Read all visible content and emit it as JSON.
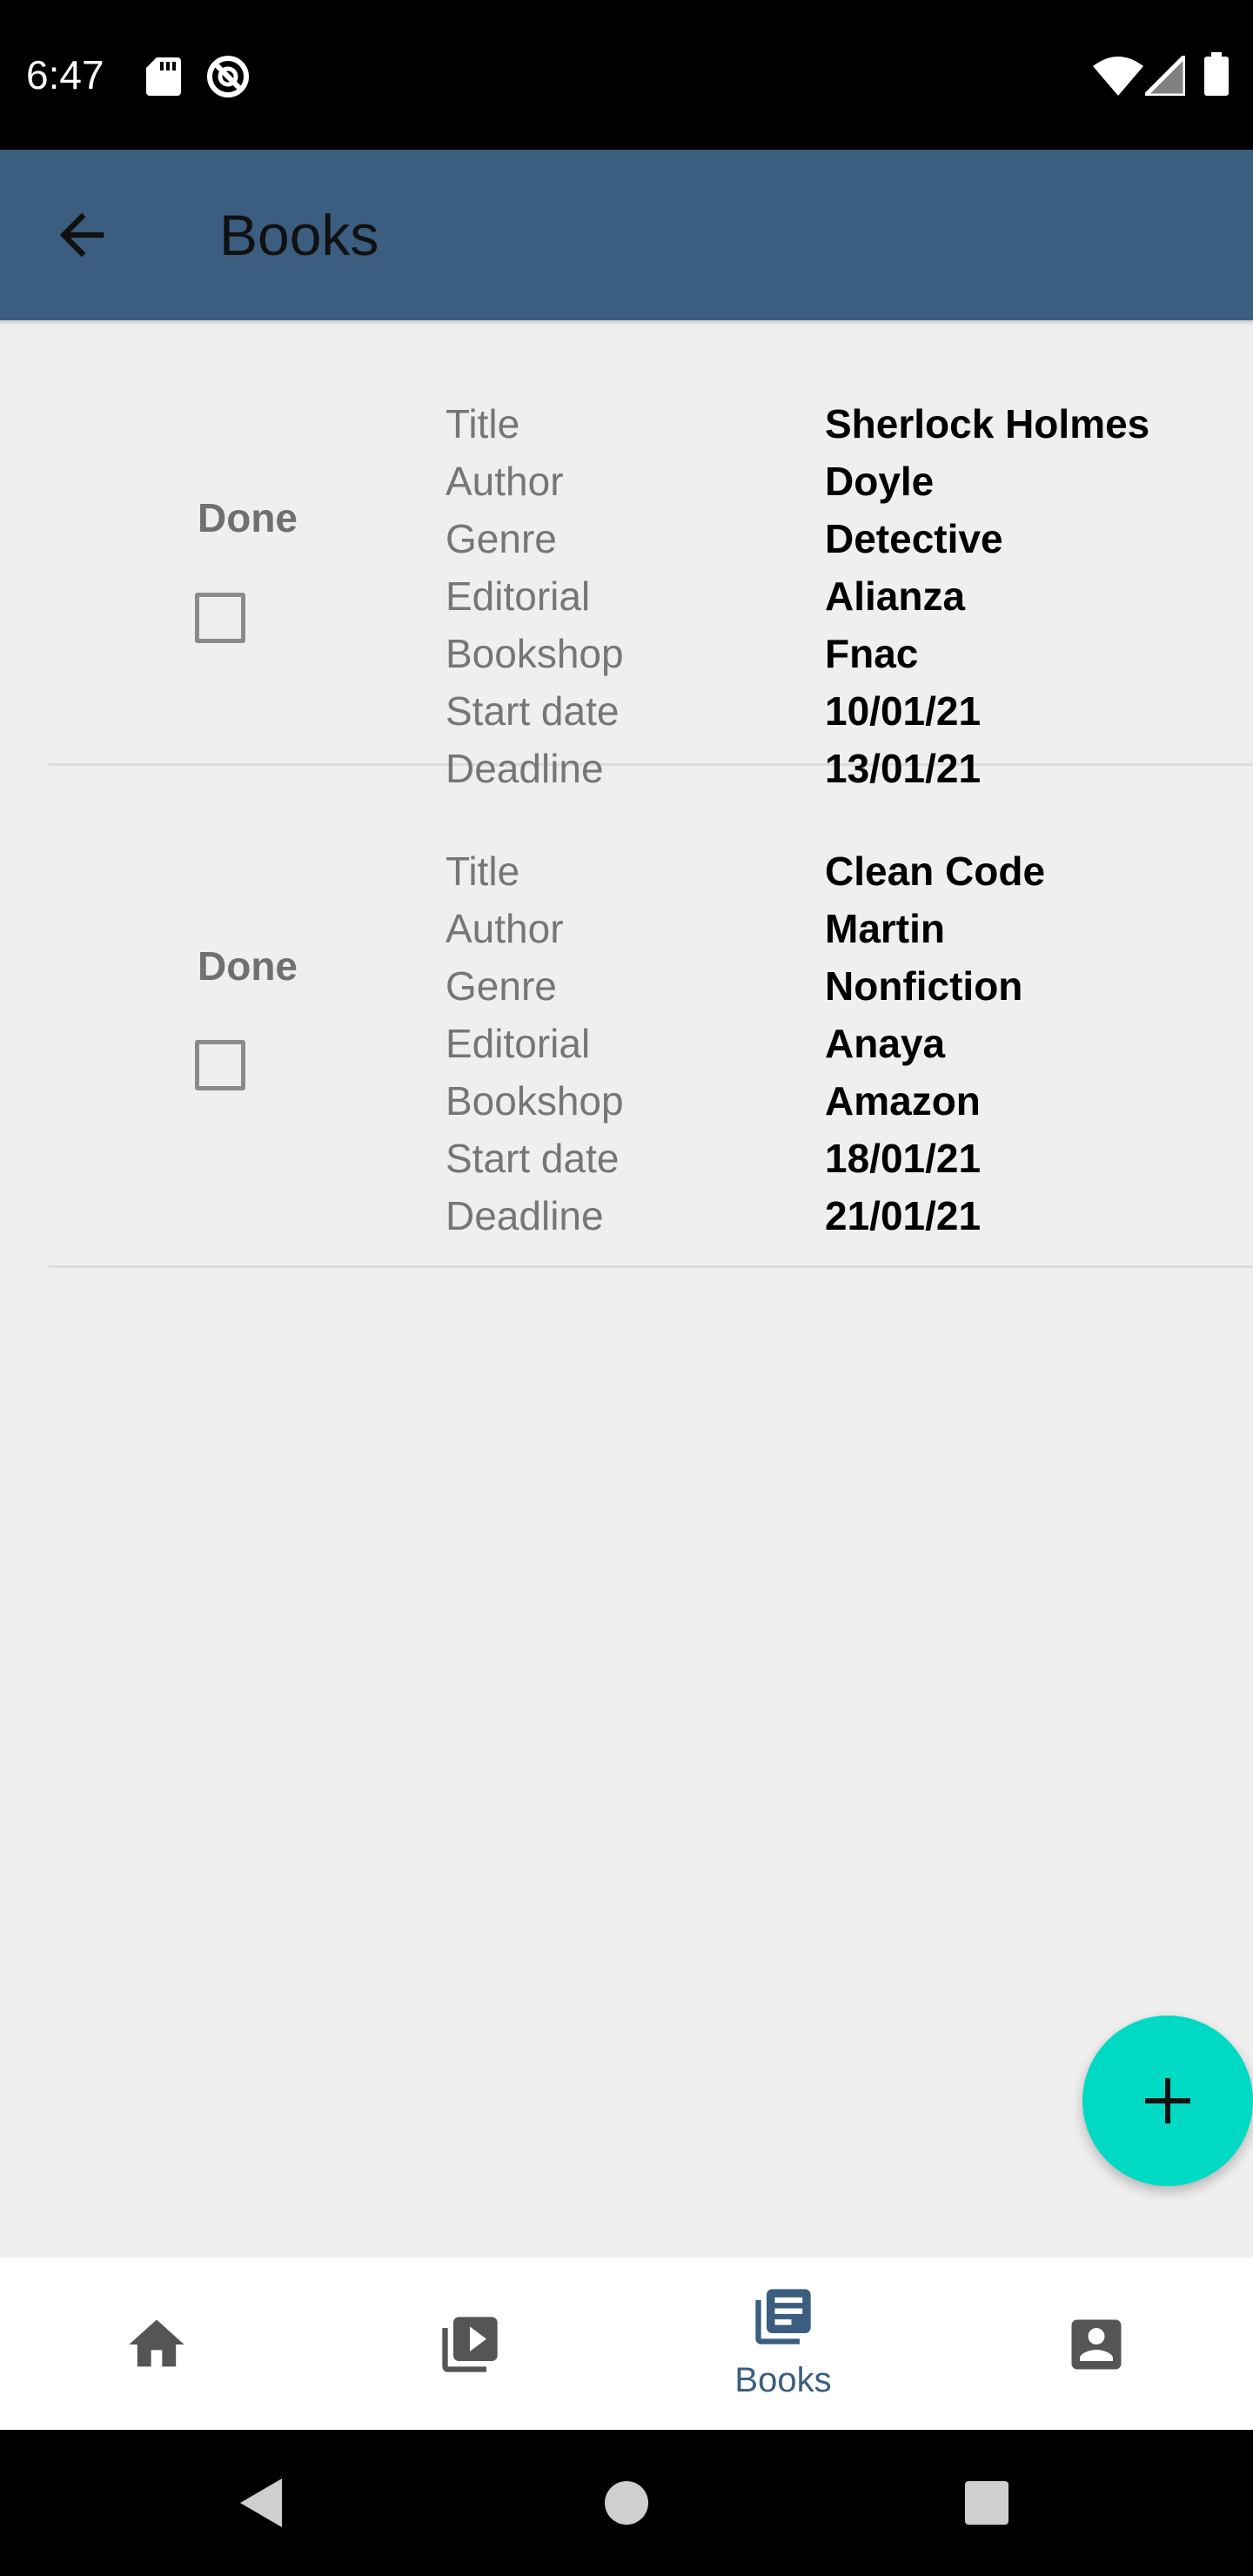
{
  "status_bar": {
    "time": "6:47",
    "left_icons": [
      "sd-card-icon",
      "do-not-disturb-icon"
    ],
    "right_icons": [
      "wifi-icon",
      "cell-signal-icon",
      "battery-icon"
    ]
  },
  "app_bar": {
    "title": "Books",
    "back_icon": "arrow-back-icon"
  },
  "books": [
    {
      "done_label": "Done",
      "done": false,
      "fields": [
        {
          "label": "Title",
          "value": "Sherlock Holmes"
        },
        {
          "label": "Author",
          "value": "Doyle"
        },
        {
          "label": "Genre",
          "value": "Detective"
        },
        {
          "label": "Editorial",
          "value": "Alianza"
        },
        {
          "label": "Bookshop",
          "value": "Fnac"
        },
        {
          "label": "Start date",
          "value": "10/01/21"
        },
        {
          "label": "Deadline",
          "value": "13/01/21"
        }
      ]
    },
    {
      "done_label": "Done",
      "done": false,
      "fields": [
        {
          "label": "Title",
          "value": "Clean Code"
        },
        {
          "label": "Author",
          "value": "Martin"
        },
        {
          "label": "Genre",
          "value": "Nonfiction"
        },
        {
          "label": "Editorial",
          "value": "Anaya"
        },
        {
          "label": "Bookshop",
          "value": "Amazon"
        },
        {
          "label": "Start date",
          "value": "18/01/21"
        },
        {
          "label": "Deadline",
          "value": "21/01/21"
        }
      ]
    }
  ],
  "fab": {
    "icon": "plus-icon"
  },
  "bottom_nav": {
    "items": [
      {
        "icon": "home-icon",
        "label": "",
        "active": false
      },
      {
        "icon": "video-library-icon",
        "label": "",
        "active": false
      },
      {
        "icon": "books-icon",
        "label": "Books",
        "active": true
      },
      {
        "icon": "contact-card-icon",
        "label": "",
        "active": false
      }
    ]
  },
  "colors": {
    "app_bar": "#3b5e80",
    "fab": "#00d9c3",
    "active_nav": "#3b5e80",
    "inactive_nav": "#555555",
    "background": "#efefef"
  },
  "system_nav": {
    "icons": [
      "back-triangle-icon",
      "home-circle-icon",
      "recents-square-icon"
    ]
  }
}
